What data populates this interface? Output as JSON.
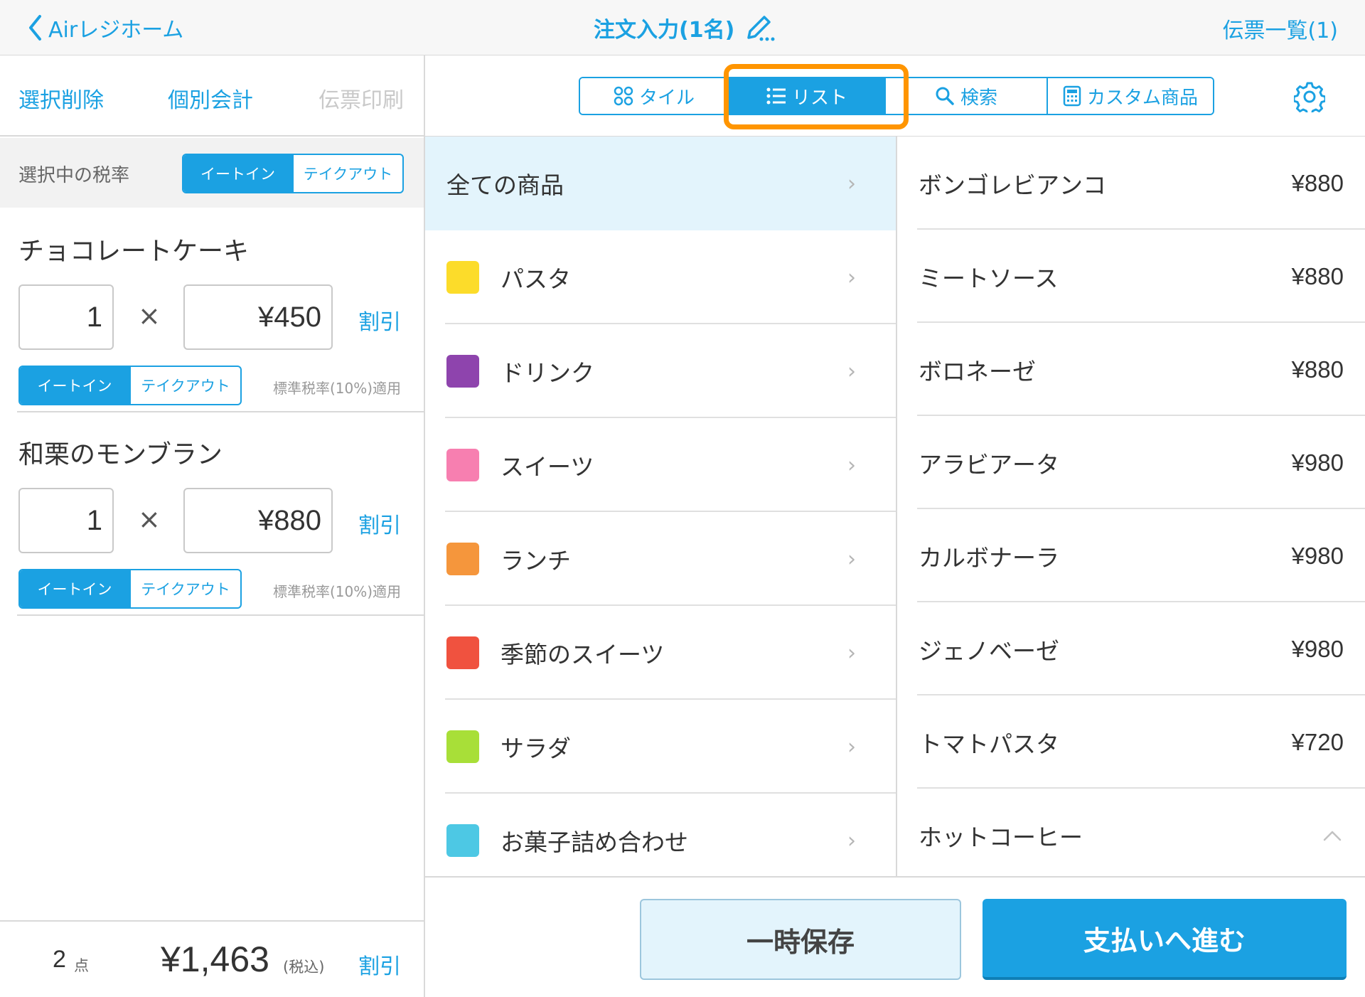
{
  "header": {
    "back_label": "Airレジホーム",
    "title": "注文入力(1名)",
    "slips_label": "伝票一覧(1)"
  },
  "left": {
    "actions": [
      "選択削除",
      "個別会計",
      "伝票印刷"
    ],
    "tax_label": "選択中の税率",
    "eat_in": "イートイン",
    "take_out": "テイクアウト",
    "items": [
      {
        "name": "チョコレートケーキ",
        "qty": "1",
        "times": "×",
        "price": "¥450",
        "discount": "割引",
        "tax_note": "標準税率(10%)適用"
      },
      {
        "name": "和栗のモンブラン",
        "qty": "1",
        "times": "×",
        "price": "¥880",
        "discount": "割引",
        "tax_note": "標準税率(10%)適用"
      }
    ],
    "footer": {
      "count": "2",
      "count_unit": "点",
      "total": "¥1,463",
      "tax_incl": "(税込)",
      "discount": "割引"
    }
  },
  "tabs": [
    {
      "label": "タイル",
      "icon": "grid-icon",
      "selected": false
    },
    {
      "label": "リスト",
      "icon": "list-icon",
      "selected": true
    },
    {
      "label": "検索",
      "icon": "search-icon",
      "selected": false
    },
    {
      "label": "カスタム商品",
      "icon": "calculator-icon",
      "selected": false
    }
  ],
  "categories": [
    {
      "label": "全ての商品",
      "color": null
    },
    {
      "label": "パスタ",
      "color": "#fcdc2a"
    },
    {
      "label": "ドリンク",
      "color": "#8e44ad"
    },
    {
      "label": "スイーツ",
      "color": "#f77fb0"
    },
    {
      "label": "ランチ",
      "color": "#f5963c"
    },
    {
      "label": "季節のスイーツ",
      "color": "#f0523f"
    },
    {
      "label": "サラダ",
      "color": "#a8df38"
    },
    {
      "label": "お菓子詰め合わせ",
      "color": "#4dc8e4"
    }
  ],
  "products": [
    {
      "name": "ボンゴレビアンコ",
      "price": "¥880"
    },
    {
      "name": "ミートソース",
      "price": "¥880"
    },
    {
      "name": "ボロネーゼ",
      "price": "¥880"
    },
    {
      "name": "アラビアータ",
      "price": "¥980"
    },
    {
      "name": "カルボナーラ",
      "price": "¥980"
    },
    {
      "name": "ジェノベーゼ",
      "price": "¥980"
    },
    {
      "name": "トマトパスタ",
      "price": "¥720"
    },
    {
      "name": "ホットコーヒー",
      "price": ""
    }
  ],
  "bottom": {
    "save_label": "一時保存",
    "pay_label": "支払いへ進む"
  },
  "colors": {
    "accent": "#1ba1e2",
    "highlight": "#ff9500"
  }
}
